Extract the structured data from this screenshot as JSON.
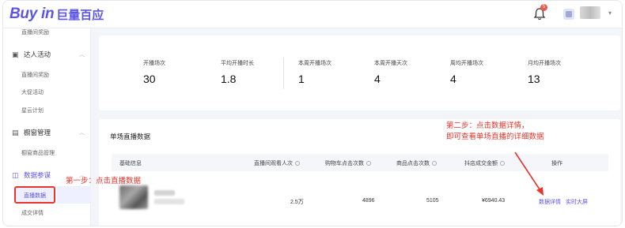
{
  "header": {
    "logo_main": "Buy in",
    "logo_sub": "巨量百应",
    "notification_count": "5",
    "accent": "#5b54e8"
  },
  "sidebar": {
    "top_sub": "直播间奖励",
    "groups": [
      {
        "label": "达人活动",
        "icon": "user-icon",
        "items": [
          "直播间奖励",
          "大促活动",
          "星云计划"
        ]
      },
      {
        "label": "橱窗管理",
        "icon": "window-icon",
        "items": [
          "橱窗商品管理"
        ]
      },
      {
        "label": "数据参谋",
        "icon": "data-icon",
        "items": [
          "直播数据",
          "成交详情"
        ]
      }
    ],
    "active_item": "直播数据"
  },
  "stats": [
    {
      "label": "开播场次",
      "value": "30"
    },
    {
      "label": "平均开播时长",
      "value": "1.8"
    },
    {
      "label": "本周开播场次",
      "value": "1"
    },
    {
      "label": "本周开播天次",
      "value": "4"
    },
    {
      "label": "周均开播场次",
      "value": "4"
    },
    {
      "label": "月均开播场次",
      "value": "13"
    }
  ],
  "live_table": {
    "title": "单场直播数据",
    "columns": [
      "基础信息",
      "直播间观看人次",
      "购物车点击次数",
      "商品点击次数",
      "抖店成交金额",
      "操作"
    ],
    "rows": [
      {
        "viewers": "2.5万",
        "cart_clicks": "4896",
        "product_clicks": "5105",
        "gmv": "¥6940.43",
        "action_detail": "数据详情",
        "action_live": "实时大屏"
      }
    ]
  },
  "annotations": {
    "step1": "第一步：点击直播数据",
    "step2_line1": "第二步：点击数据详情，",
    "step2_line2": "即可查看单场直播的详细数据",
    "color": "#e5352d"
  }
}
